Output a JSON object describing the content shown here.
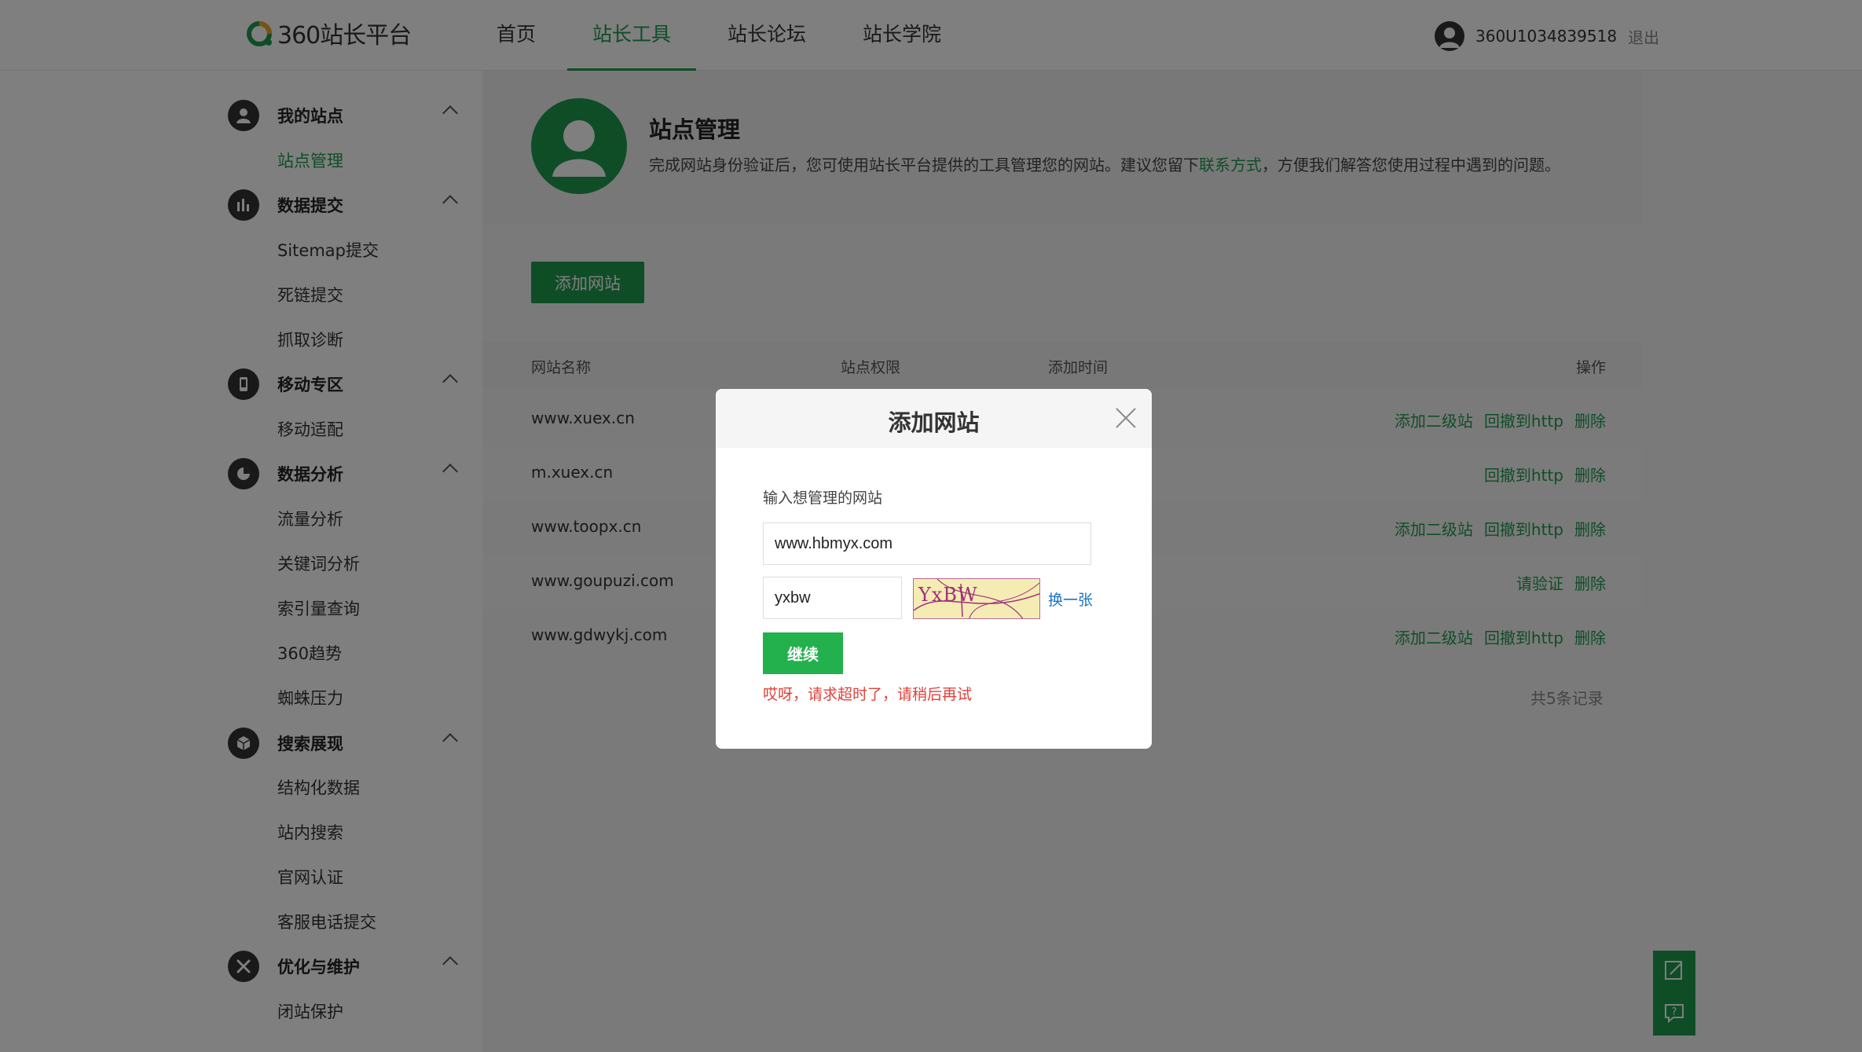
{
  "header": {
    "logo_text": "360站长平台",
    "nav": [
      {
        "label": "首页"
      },
      {
        "label": "站长工具"
      },
      {
        "label": "站长论坛"
      },
      {
        "label": "站长学院"
      }
    ],
    "active_nav": "站长工具",
    "username": "360U1034839518",
    "logout": "退出"
  },
  "sidebar": {
    "groups": [
      {
        "label": "我的站点",
        "icon": "user-icon",
        "items": [
          "站点管理"
        ]
      },
      {
        "label": "数据提交",
        "icon": "bar-chart-icon",
        "items": [
          "Sitemap提交",
          "死链提交",
          "抓取诊断"
        ]
      },
      {
        "label": "移动专区",
        "icon": "mobile-icon",
        "items": [
          "移动适配"
        ]
      },
      {
        "label": "数据分析",
        "icon": "pie-chart-icon",
        "items": [
          "流量分析",
          "关键词分析",
          "索引量查询",
          "360趋势",
          "蜘蛛压力"
        ]
      },
      {
        "label": "搜索展现",
        "icon": "cube-icon",
        "items": [
          "结构化数据",
          "站内搜索",
          "官网认证",
          "客服电话提交"
        ]
      },
      {
        "label": "优化与维护",
        "icon": "tools-icon",
        "items": [
          "闭站保护"
        ]
      }
    ],
    "active_item": "站点管理"
  },
  "banner": {
    "title": "站点管理",
    "desc_before": "完成网站身份验证后，您可使用站长平台提供的工具管理您的网站。建议您留下",
    "desc_link": "联系方式",
    "desc_after": "，方便我们解答您使用过程中遇到的问题。"
  },
  "main": {
    "add_button": "添加网站",
    "table": {
      "headers": {
        "name": "网站名称",
        "perm": "站点权限",
        "time": "添加时间",
        "ops": "操作"
      },
      "rows": [
        {
          "name": "www.xuex.cn",
          "ops": [
            "添加二级站",
            "回撤到http",
            "删除"
          ]
        },
        {
          "name": "m.xuex.cn",
          "ops": [
            "回撤到http",
            "删除"
          ]
        },
        {
          "name": "www.toopx.cn",
          "ops": [
            "添加二级站",
            "回撤到http",
            "删除"
          ]
        },
        {
          "name": "www.goupuzi.com",
          "ops": [
            "请验证",
            "删除"
          ]
        },
        {
          "name": "www.gdwykj.com",
          "ops": [
            "添加二级站",
            "回撤到http",
            "删除"
          ]
        }
      ],
      "total": "共5条记录"
    }
  },
  "modal": {
    "title": "添加网站",
    "field_label": "输入想管理的网站",
    "url_value": "www.hbmyx.com",
    "captcha_value": "yxbw",
    "captcha_image_text": "YxBW",
    "refresh": "换一张",
    "continue": "继续",
    "error": "哎呀，请求超时了，请稍后再试"
  },
  "colors": {
    "brand": "#1e9a4f",
    "button": "#22b14c",
    "error": "#e0413a",
    "link": "#1a73c9"
  }
}
